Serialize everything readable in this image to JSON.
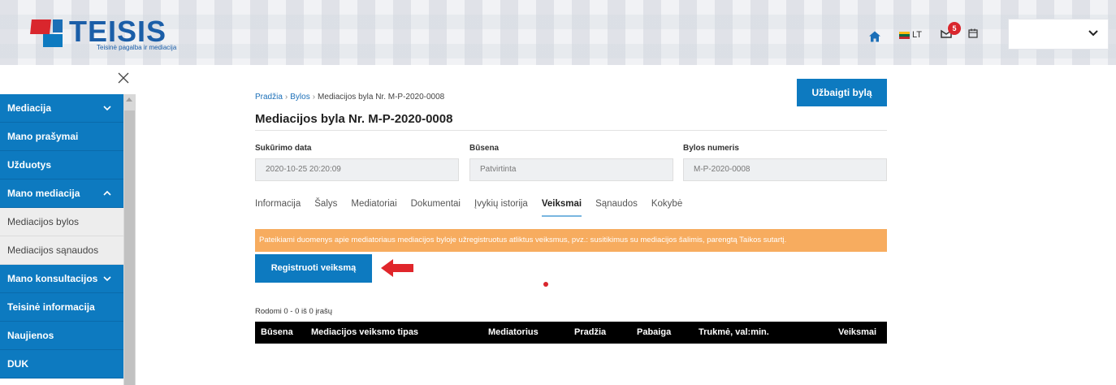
{
  "brand": {
    "name": "TEISIS",
    "tagline": "Teisinė pagalba ir mediacija"
  },
  "header": {
    "lang": "LT",
    "notifications": "5"
  },
  "sidebar": {
    "items": [
      {
        "label": "Mediacija",
        "kind": "section",
        "chevron": "down"
      },
      {
        "label": "Mano prašymai",
        "kind": "section"
      },
      {
        "label": "Užduotys",
        "kind": "section"
      },
      {
        "label": "Mano mediacija",
        "kind": "section",
        "chevron": "up"
      },
      {
        "label": "Mediacijos bylos",
        "kind": "sub"
      },
      {
        "label": "Mediacijos sąnaudos",
        "kind": "sub"
      },
      {
        "label": "Mano konsultacijos",
        "kind": "section",
        "chevron": "down"
      },
      {
        "label": "Teisinė informacija",
        "kind": "section"
      },
      {
        "label": "Naujienos",
        "kind": "section"
      },
      {
        "label": "DUK",
        "kind": "section"
      }
    ]
  },
  "breadcrumb": {
    "home": "Pradžia",
    "cases": "Bylos",
    "current": "Mediacijos byla Nr. M-P-2020-0008"
  },
  "page": {
    "title": "Mediacijos byla Nr. M-P-2020-0008",
    "finish_button": "Užbaigti bylą"
  },
  "fields": {
    "created_label": "Sukūrimo data",
    "created_value": "2020-10-25 20:20:09",
    "status_label": "Būsena",
    "status_value": "Patvirtinta",
    "number_label": "Bylos numeris",
    "number_value": "M-P-2020-0008"
  },
  "tabs": [
    "Informacija",
    "Šalys",
    "Mediatoriai",
    "Dokumentai",
    "Įvykių istorija",
    "Veiksmai",
    "Sąnaudos",
    "Kokybė"
  ],
  "active_tab": "Veiksmai",
  "alert": "Pateikiami duomenys apie mediatoriaus mediacijos byloje užregistruotus atliktus veiksmus, pvz.: susitikimus su mediacijos šalimis, parengtą Taikos sutartį.",
  "register_button": "Registruoti veiksmą",
  "table": {
    "count": "Rodomi 0 - 0 iš 0 įrašų",
    "columns": [
      "Būsena",
      "Mediacijos veiksmo tipas",
      "Mediatorius",
      "Pradžia",
      "Pabaiga",
      "Trukmė, val:min.",
      "Veiksmai"
    ]
  },
  "colors": {
    "primary": "#0d7ac0",
    "accent_red": "#d9262d",
    "alert": "#f7ac5f"
  }
}
